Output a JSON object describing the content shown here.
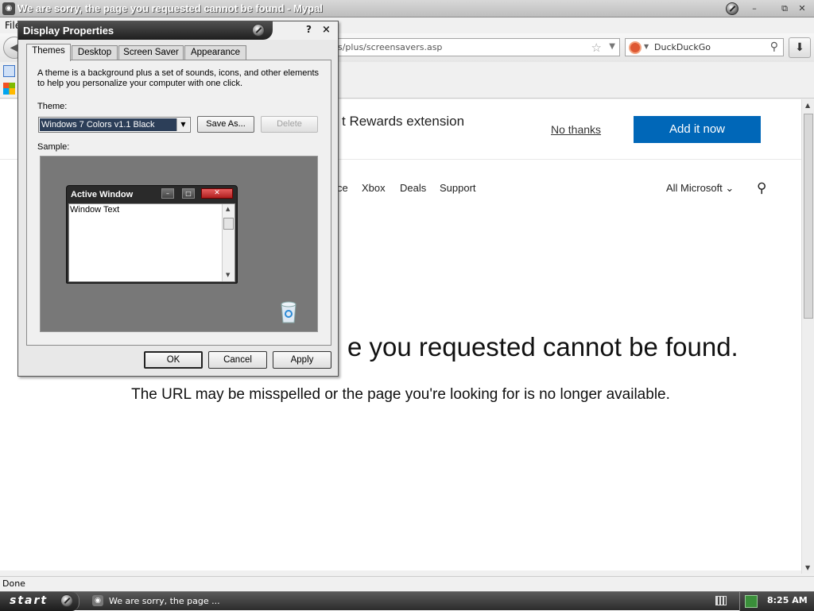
{
  "browser": {
    "title": "We are sorry, the page you requested cannot be found - Mypal",
    "menu_file": "File",
    "url_fragment": "s/plus/screensavers.asp",
    "search_placeholder": "DuckDuckGo",
    "status": "Done"
  },
  "page": {
    "promo_text": "t Rewards extension",
    "no_thanks": "No thanks",
    "add_it_now": "Add it now",
    "nav": [
      "ce",
      "Xbox",
      "Deals",
      "Support"
    ],
    "all_microsoft": "All Microsoft ⌄",
    "error_title": "e you requested cannot be found.",
    "error_subtitle": "The URL may be misspelled or the page you're looking for is no longer available."
  },
  "dialog": {
    "title": "Display Properties",
    "help": "?",
    "close": "×",
    "tabs": [
      "Themes",
      "Desktop",
      "Screen Saver",
      "Appearance"
    ],
    "description": "A theme is a background plus a set of sounds, icons, and other elements to help you personalize your computer with one click.",
    "theme_label": "Theme:",
    "theme_value": "Windows 7 Colors v1.1 Black",
    "save_as": "Save As...",
    "delete": "Delete",
    "sample_label": "Sample:",
    "preview_title": "Active Window",
    "preview_text": "Window Text",
    "ok": "OK",
    "cancel": "Cancel",
    "apply": "Apply"
  },
  "taskbar": {
    "start": "start",
    "task_item": "We are sorry, the page ...",
    "clock": "8:25 AM"
  },
  "colors": {
    "accent_button": "#0067b8",
    "selected_theme_bg": "#2c3e58"
  }
}
